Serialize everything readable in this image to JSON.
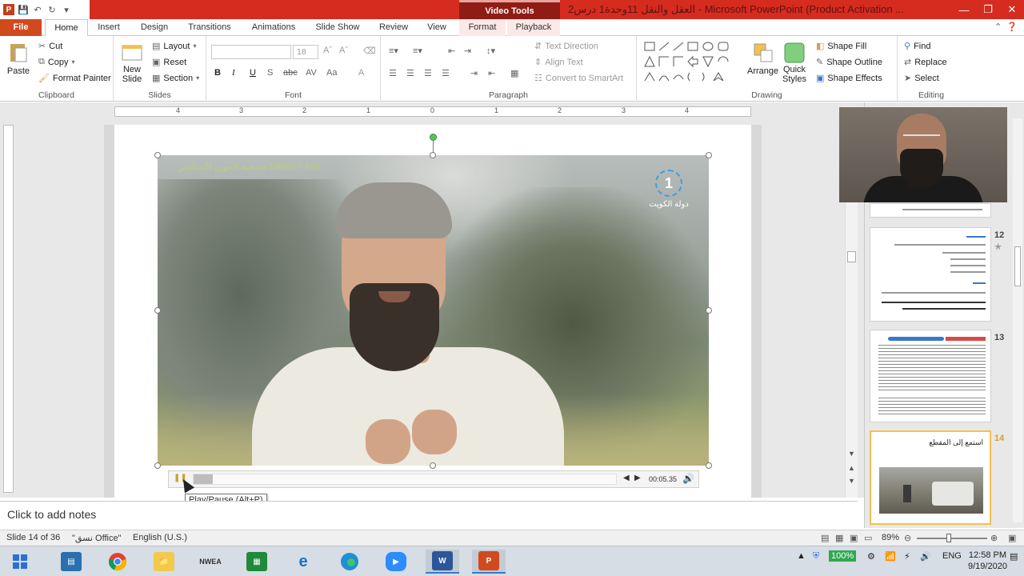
{
  "window": {
    "context_tab_group": "Video Tools",
    "title": "العقل والنقل 11وحدة1 درس2 - Microsoft PowerPoint (Product Activation ..."
  },
  "tabs": [
    {
      "label": "File"
    },
    {
      "label": "Home"
    },
    {
      "label": "Insert"
    },
    {
      "label": "Design"
    },
    {
      "label": "Transitions"
    },
    {
      "label": "Animations"
    },
    {
      "label": "Slide Show"
    },
    {
      "label": "Review"
    },
    {
      "label": "View"
    },
    {
      "label": "Format"
    },
    {
      "label": "Playback"
    }
  ],
  "ribbon": {
    "clipboard": {
      "label": "Clipboard",
      "paste": "Paste",
      "cut": "Cut",
      "copy": "Copy",
      "format_painter": "Format Painter"
    },
    "slides": {
      "label": "Slides",
      "new_slide_1": "New",
      "new_slide_2": "Slide",
      "layout": "Layout",
      "reset": "Reset",
      "section": "Section"
    },
    "font": {
      "label": "Font",
      "font_size": "18",
      "bold": "B",
      "italic": "I",
      "underline": "U",
      "shadow": "S",
      "strike": "abc",
      "spacing": "AV",
      "case": "Aa",
      "color": "A"
    },
    "paragraph": {
      "label": "Paragraph",
      "text_direction": "Text Direction",
      "align_text": "Align Text",
      "convert": "Convert to SmartArt"
    },
    "drawing": {
      "label": "Drawing",
      "arrange": "Arrange",
      "quick_styles_1": "Quick",
      "quick_styles_2": "Styles",
      "shape_fill": "Shape Fill",
      "shape_outline": "Shape Outline",
      "shape_effects": "Shape Effects"
    },
    "editing": {
      "label": "Editing",
      "find": "Find",
      "replace": "Replace",
      "select": "Select"
    }
  },
  "ruler": {
    "marks": [
      "4",
      "3",
      "2",
      "1",
      "0",
      "1",
      "2",
      "3",
      "4"
    ]
  },
  "video": {
    "logo_left": "جمعية العون المباشر DIRECT AID",
    "logo_right_number": "1",
    "logo_right_text": "دولة الكويت"
  },
  "media_controls": {
    "time": "00:05.35",
    "progress": 0.045
  },
  "tooltip": "Play/Pause (Alt+P)",
  "thumbnails": [
    {
      "number": "12"
    },
    {
      "number": "13"
    },
    {
      "number": "14",
      "title": "استمع إلى المقطع"
    }
  ],
  "notes_placeholder": "Click to add notes",
  "status": {
    "slide": "Slide 14 of 36",
    "theme": "\"نسق Office\"",
    "language": "English (U.S.)",
    "zoom": "89%"
  },
  "taskbar": {
    "battery": "100%",
    "language": "ENG",
    "time": "12:58 PM",
    "date": "9/19/2020"
  },
  "colors": {
    "accent": "#d62b1f",
    "file_tab": "#d04a1e",
    "context_tab": "#8f1d15"
  }
}
